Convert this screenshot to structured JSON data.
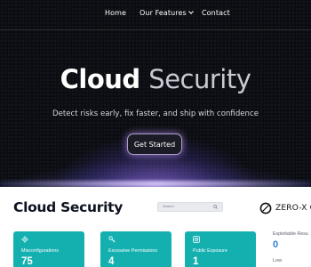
{
  "nav": {
    "items": [
      "Home",
      "Our Features",
      "Contact"
    ]
  },
  "hero": {
    "title_word1": "Cloud",
    "title_word2": "Security",
    "subtitle": "Detect risks early, fix faster, and ship with confidence",
    "cta_label": "Get Started"
  },
  "dashboard": {
    "title": "Cloud Security",
    "search_placeholder": "Search",
    "brand_name": "ZERO-X CL",
    "cards": [
      {
        "label": "Misconfigurations",
        "value": "75",
        "icon": "gear-icon"
      },
      {
        "label": "Excessive Permissions",
        "value": "4",
        "icon": "key-icon"
      },
      {
        "label": "Public Exposure",
        "value": "1",
        "icon": "globe-icon"
      }
    ],
    "exploitable": {
      "label": "Exploitable Resu",
      "value": "0",
      "level": "Low"
    }
  },
  "colors": {
    "hero_bg": "#0b0d12",
    "card_teal": "#14b0b0",
    "accent_blue": "#2f7fd1",
    "glow_purple": "#b896ff"
  }
}
